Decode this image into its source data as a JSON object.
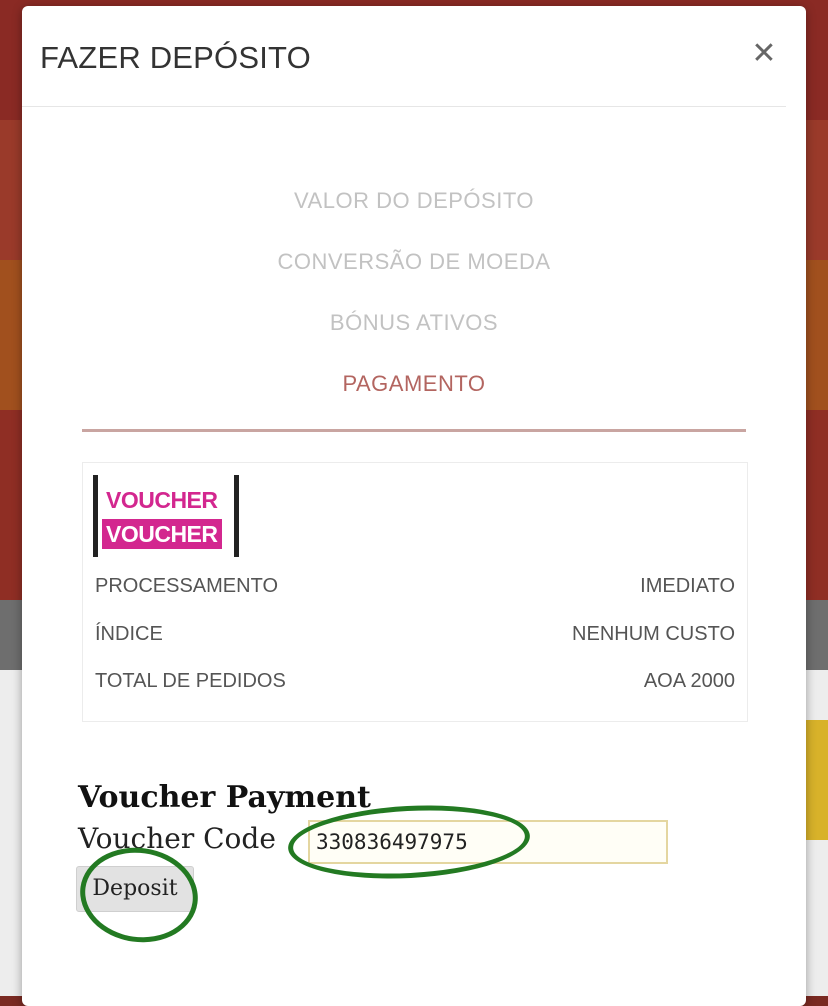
{
  "modal": {
    "title": "FAZER DEPÓSITO",
    "close_glyph": "✕"
  },
  "steps": [
    {
      "label": "VALOR DO DEPÓSITO",
      "active": false
    },
    {
      "label": "CONVERSÃO DE MOEDA",
      "active": false
    },
    {
      "label": "BÓNUS ATIVOS",
      "active": false
    },
    {
      "label": "PAGAMENTO",
      "active": true
    }
  ],
  "payment_method": {
    "logo_line1": "VOUCHER",
    "logo_line2": "VOUCHER",
    "rows": [
      {
        "key": "PROCESSAMENTO",
        "value": "IMEDIATO"
      },
      {
        "key": "ÍNDICE",
        "value": "NENHUM CUSTO"
      },
      {
        "key": "TOTAL DE PEDIDOS",
        "value": "AOA 2000"
      }
    ]
  },
  "voucher_form": {
    "title": "Voucher Payment",
    "code_label": "Voucher Code",
    "code_value": "330836497975",
    "deposit_label": "Deposit"
  },
  "colors": {
    "active_step": "#b36560",
    "inactive_step": "#c2c2c2",
    "logo_pink": "#d3278f",
    "annotation_green": "#237a22"
  }
}
